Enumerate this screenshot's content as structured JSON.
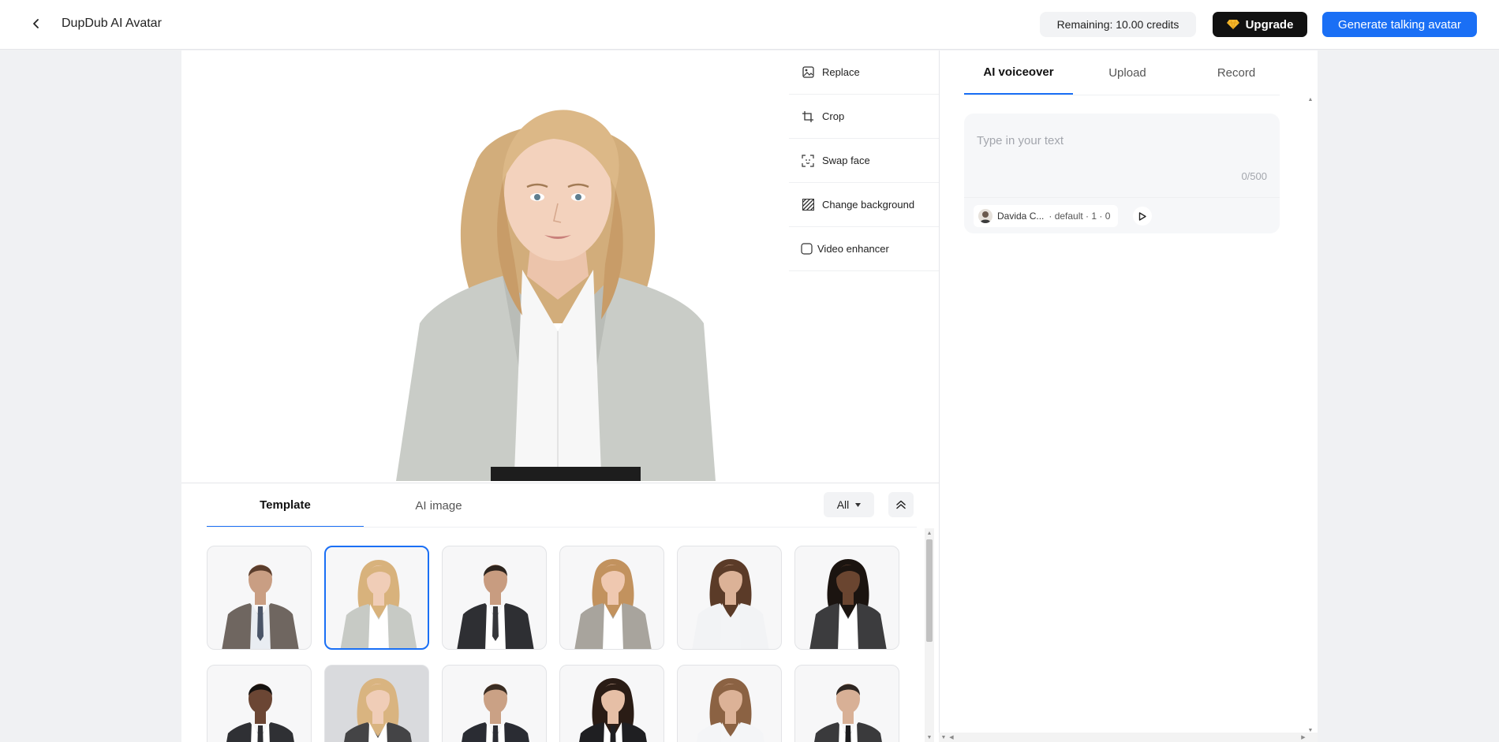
{
  "header": {
    "back_icon": "chevron-left-icon",
    "title": "DupDub AI Avatar",
    "credits": "Remaining: 10.00 credits",
    "upgrade_label": "Upgrade",
    "upgrade_icon": "diamond-icon",
    "generate_label": "Generate talking avatar",
    "accent_color": "#1a6ff5"
  },
  "tools": [
    {
      "label": "Replace",
      "icon": "image-icon"
    },
    {
      "label": "Crop",
      "icon": "crop-icon"
    },
    {
      "label": "Swap face",
      "icon": "face-scan-icon"
    },
    {
      "label": "Change background",
      "icon": "background-pattern-icon"
    },
    {
      "label": "Video enhancer",
      "icon": "checkbox-icon"
    }
  ],
  "library": {
    "tabs": [
      "Template",
      "AI image"
    ],
    "active_tab": "Template",
    "filter_value": "All",
    "collapse_icon": "double-chevron-up-icon"
  },
  "templates": [
    {
      "kind": "man",
      "suit": "#6f6660",
      "skin": "#c99e83",
      "hair": "#5b3d2c",
      "shirt": "#e9edf2",
      "tie": "#4a5568"
    },
    {
      "kind": "woman",
      "suit": "#c7cac5",
      "skin": "#f0cdb7",
      "hair": "#d8b27c",
      "shirt": "#ffffff",
      "tie": ""
    },
    {
      "kind": "man",
      "suit": "#2e2f33",
      "skin": "#c89c80",
      "hair": "#2d241e",
      "shirt": "#ffffff",
      "tie": "#35363a"
    },
    {
      "kind": "woman",
      "suit": "#a8a49d",
      "skin": "#efc8b0",
      "hair": "#c2925e",
      "shirt": "#ffffff",
      "tie": ""
    },
    {
      "kind": "woman",
      "suit": "#f2f3f5",
      "skin": "#dcb297",
      "hair": "#5b3b28",
      "shirt": "#f3f4f6",
      "tie": ""
    },
    {
      "kind": "woman",
      "suit": "#3c3c3e",
      "skin": "#6a4530",
      "hair": "#1b1410",
      "shirt": "#ffffff",
      "tie": ""
    },
    {
      "kind": "man",
      "suit": "#2f3034",
      "skin": "#6b4634",
      "hair": "#151210",
      "shirt": "#ffffff",
      "tie": "#2f3034"
    },
    {
      "kind": "woman",
      "suit": "#444446",
      "skin": "#f0cdb7",
      "hair": "#d9b480",
      "shirt": "#ffffff",
      "tie": ""
    },
    {
      "kind": "man",
      "suit": "#2a2c33",
      "skin": "#caa185",
      "hair": "#3a2c22",
      "shirt": "#ffffff",
      "tie": "#2a2c33"
    },
    {
      "kind": "woman",
      "suit": "#1f1f22",
      "skin": "#e6bfa6",
      "hair": "#2a1c15",
      "shirt": "#ffffff",
      "tie": "#1f1f22"
    },
    {
      "kind": "woman",
      "suit": "#f4f5f7",
      "skin": "#dcb297",
      "hair": "#8b6243",
      "shirt": "#f5f6f8",
      "tie": ""
    },
    {
      "kind": "man",
      "suit": "#3a3a3c",
      "skin": "#d8b096",
      "hair": "#2e2622",
      "shirt": "#ffffff",
      "tie": "#1c1c1e"
    }
  ],
  "selected_template": 1,
  "voiceover": {
    "tabs": [
      "AI voiceover",
      "Upload",
      "Record"
    ],
    "active_tab": "AI voiceover",
    "text_value": "",
    "placeholder": "Type in your text",
    "counter": "0/500",
    "voice_name": "Davida C...",
    "voice_meta": "· default · 1 · 0",
    "play_icon": "play-icon"
  }
}
